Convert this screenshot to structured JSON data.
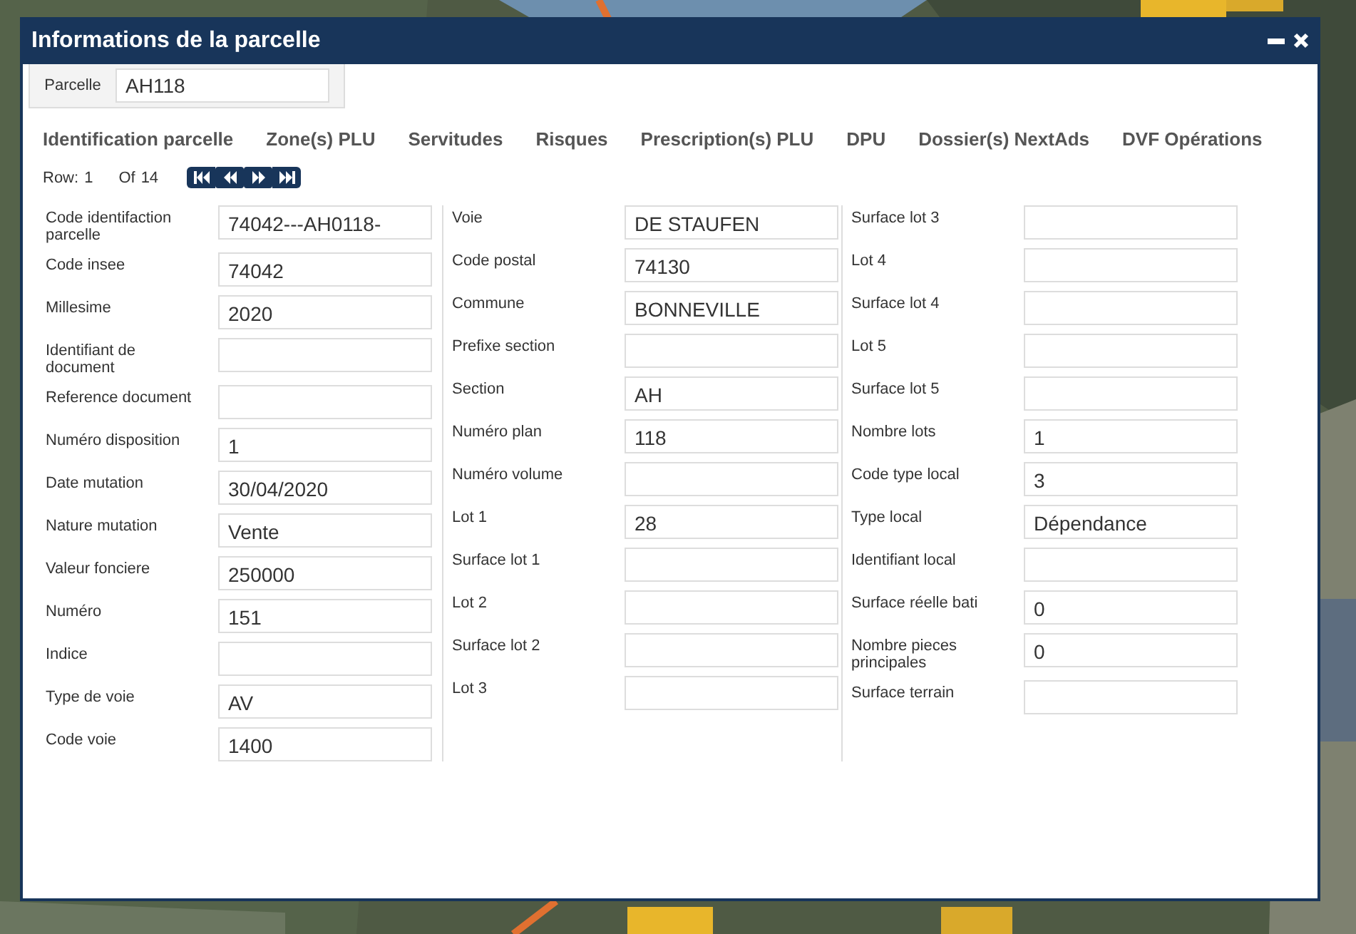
{
  "window": {
    "title": "Informations de la parcelle"
  },
  "parcel": {
    "label": "Parcelle",
    "value": "AH118"
  },
  "tabs": [
    {
      "label": "Identification parcelle"
    },
    {
      "label": "Zone(s) PLU"
    },
    {
      "label": "Servitudes"
    },
    {
      "label": "Risques"
    },
    {
      "label": "Prescription(s) PLU"
    },
    {
      "label": "DPU"
    },
    {
      "label": "Dossier(s) NextAds"
    },
    {
      "label": "DVF Opérations"
    }
  ],
  "pager": {
    "row_label": "Row:",
    "row": "1",
    "of_label": "Of",
    "total": "14"
  },
  "columns": [
    [
      {
        "label": "Code identifaction parcelle",
        "value": "74042---AH0118-"
      },
      {
        "label": "Code insee",
        "value": "74042"
      },
      {
        "label": "Millesime",
        "value": "2020"
      },
      {
        "label": "Identifiant de document"
      },
      {
        "label": "Reference document"
      },
      {
        "label": "Numéro disposition",
        "value": "1"
      },
      {
        "label": "Date mutation",
        "value": "30/04/2020"
      },
      {
        "label": "Nature mutation",
        "value": "Vente"
      },
      {
        "label": "Valeur fonciere",
        "value": "250000"
      },
      {
        "label": "Numéro",
        "value": "151"
      },
      {
        "label": "Indice"
      },
      {
        "label": "Type de voie",
        "value": "AV"
      },
      {
        "label": "Code voie",
        "value": "1400"
      }
    ],
    [
      {
        "label": "Voie",
        "value": "DE STAUFEN"
      },
      {
        "label": "Code postal",
        "value": "74130"
      },
      {
        "label": "Commune",
        "value": "BONNEVILLE"
      },
      {
        "label": "Prefixe section"
      },
      {
        "label": "Section",
        "value": "AH"
      },
      {
        "label": "Numéro plan",
        "value": "118"
      },
      {
        "label": "Numéro volume"
      },
      {
        "label": "Lot 1",
        "value": "28"
      },
      {
        "label": "Surface lot 1"
      },
      {
        "label": "Lot 2"
      },
      {
        "label": "Surface lot 2"
      },
      {
        "label": "Lot 3"
      }
    ],
    [
      {
        "label": "Surface lot 3"
      },
      {
        "label": "Lot 4"
      },
      {
        "label": "Surface lot 4"
      },
      {
        "label": "Lot 5"
      },
      {
        "label": "Surface lot 5"
      },
      {
        "label": "Nombre lots",
        "value": "1"
      },
      {
        "label": "Code type local",
        "value": "3"
      },
      {
        "label": "Type local",
        "value": "Dépendance"
      },
      {
        "label": "Identifiant local"
      },
      {
        "label": "Surface réelle bati",
        "value": "0"
      },
      {
        "label": "Nombre pieces principales",
        "value": "0"
      },
      {
        "label": "Surface terrain"
      }
    ]
  ]
}
